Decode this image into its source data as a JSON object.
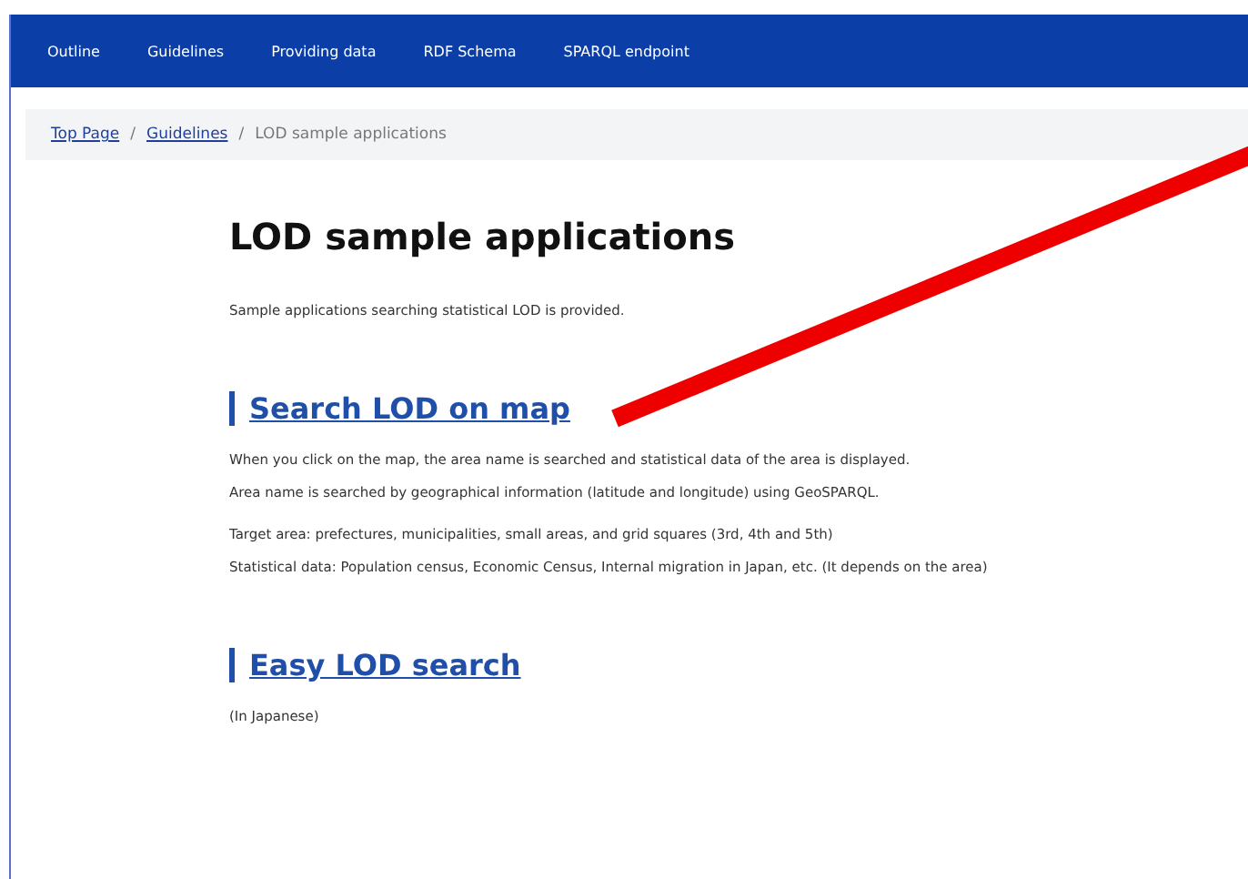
{
  "nav": {
    "items": [
      {
        "label": "Outline"
      },
      {
        "label": "Guidelines"
      },
      {
        "label": "Providing data"
      },
      {
        "label": "RDF Schema"
      },
      {
        "label": "SPARQL endpoint"
      }
    ]
  },
  "breadcrumb": [
    {
      "label": "Top Page",
      "kind": "link"
    },
    {
      "label": "Guidelines",
      "kind": "link"
    },
    {
      "label": "LOD sample applications",
      "kind": "current"
    }
  ],
  "breadcrumb_separator": "/",
  "title": "LOD sample applications",
  "intro": "Sample applications searching statistical LOD is provided.",
  "sections": [
    {
      "heading": "Search LOD on map",
      "paragraphs": [
        [
          "When you click on the map, the area name is searched and statistical data of the area is displayed.",
          "Area name is searched by geographical information (latitude and longitude) using GeoSPARQL."
        ],
        [
          "Target area: prefectures, municipalities, small areas, and grid squares (3rd, 4th and 5th)",
          "Statistical data: Population census, Economic Census, Internal migration in Japan, etc. (It depends on the area)"
        ]
      ]
    },
    {
      "heading": "Easy LOD search",
      "paragraphs": [
        [
          "(In Japanese)"
        ]
      ]
    }
  ]
}
